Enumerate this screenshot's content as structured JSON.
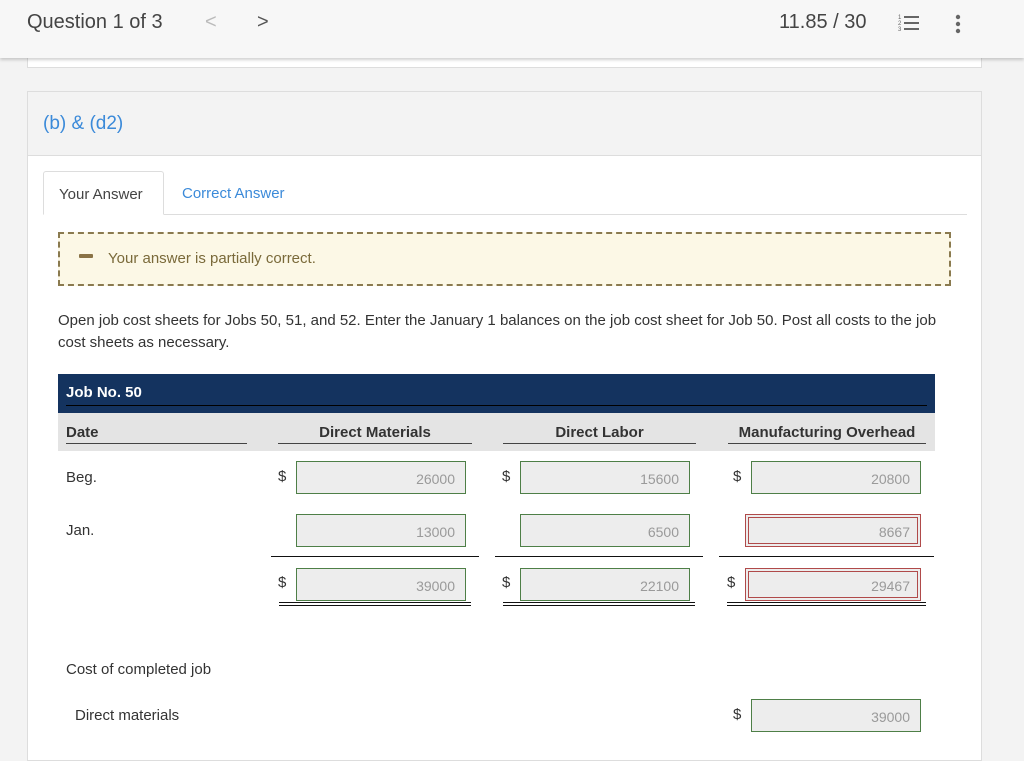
{
  "topbar": {
    "question_label": "Question 1 of 3",
    "prev_glyph": "<",
    "next_glyph": ">",
    "score": "11.85 / 30",
    "list_icon": "numbered-list-icon",
    "more_icon": "more-vertical-icon"
  },
  "card": {
    "part_label": "(b) & (d2)",
    "tabs": [
      {
        "label": "Your Answer",
        "active": true
      },
      {
        "label": "Correct Answer",
        "active": false
      }
    ],
    "notice": "Your answer is partially correct.",
    "instructions": "Open job cost sheets for Jobs 50, 51, and 52. Enter the January 1 balances on the job cost sheet for Job 50. Post all costs to the job cost sheets as necessary."
  },
  "sheet": {
    "title": "Job No. 50",
    "columns": [
      "Date",
      "Direct Materials",
      "Direct Labor",
      "Manufacturing Overhead"
    ],
    "currency": "$",
    "rows": [
      {
        "label": "Beg.",
        "dm": "26000",
        "dl": "15600",
        "moh": "20800",
        "dm_status": "correct",
        "dl_status": "correct",
        "moh_status": "correct"
      },
      {
        "label": "Jan.",
        "dm": "13000",
        "dl": "6500",
        "moh": "8667",
        "dm_status": "correct",
        "dl_status": "correct",
        "moh_status": "incorrect"
      },
      {
        "label": "",
        "dm": "39000",
        "dl": "22100",
        "moh": "29467",
        "dm_status": "correct",
        "dl_status": "correct",
        "moh_status": "incorrect"
      }
    ],
    "completed_label": "Cost of completed job",
    "completed_rows": [
      {
        "label": "Direct materials",
        "value": "39000",
        "status": "correct"
      }
    ],
    "colors": {
      "header_bg": "#14335f",
      "correct_border": "#4e7f47",
      "incorrect_border": "#b04a4a",
      "link": "#3b8ad9"
    }
  }
}
